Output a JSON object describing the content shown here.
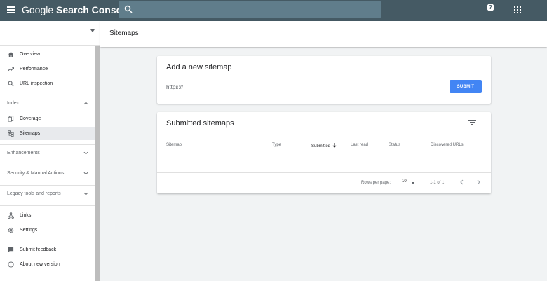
{
  "header": {
    "brand_prefix": "Google",
    "brand_name": "Search Console",
    "search_placeholder": "",
    "help_icon": "help-icon",
    "apps_icon": "apps-grid-icon"
  },
  "sidebar": {
    "property_label": "",
    "items_top": [
      {
        "label": "Overview",
        "icon": "home-icon"
      },
      {
        "label": "Performance",
        "icon": "trending-icon"
      },
      {
        "label": "URL inspection",
        "icon": "search-icon"
      }
    ],
    "sections": {
      "index": "Index",
      "enhancements": "Enhancements",
      "security": "Security & Manual Actions",
      "legacy": "Legacy tools and reports"
    },
    "index_items": [
      {
        "label": "Coverage",
        "icon": "copy-icon"
      },
      {
        "label": "Sitemaps",
        "icon": "sitemap-icon",
        "active": true
      }
    ],
    "bottom_items": [
      {
        "label": "Links",
        "icon": "links-icon"
      },
      {
        "label": "Settings",
        "icon": "gear-icon"
      },
      {
        "label": "Submit feedback",
        "icon": "feedback-icon"
      },
      {
        "label": "About new version",
        "icon": "info-icon"
      }
    ]
  },
  "main": {
    "page_title": "Sitemaps",
    "add_card": {
      "title": "Add a new sitemap",
      "url_prefix": "https://",
      "input_value": "",
      "submit_label": "SUBMIT"
    },
    "submitted_card": {
      "title": "Submitted sitemaps",
      "columns": [
        "Sitemap",
        "Type",
        "Submitted",
        "Last read",
        "Status",
        "Discovered URLs"
      ],
      "sorted_column": "Submitted",
      "rows_per_page_label": "Rows per page:",
      "rows_per_page_value": "10",
      "pagination_text": "1-1 of 1"
    }
  },
  "colors": {
    "appbar": "#455a64",
    "search_bg": "#607d8b",
    "accent": "#4285f4"
  }
}
